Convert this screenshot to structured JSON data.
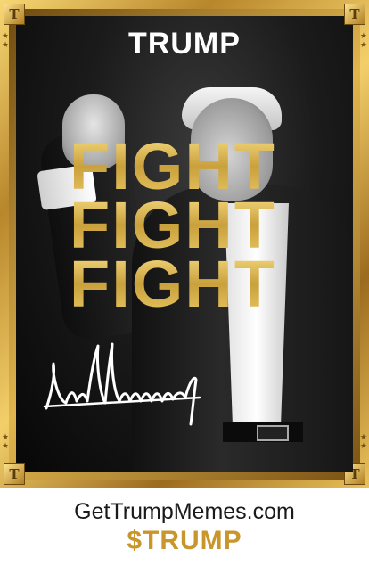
{
  "poster": {
    "title": "TRUMP",
    "fight_lines": [
      "FIGHT",
      "FIGHT",
      "FIGHT"
    ],
    "corner_badge": "T",
    "signature_icon": "signature-icon",
    "colors": {
      "gold": "#d4a843",
      "frame_dark": "#7a5214",
      "background": "#111111",
      "title": "#ffffff"
    }
  },
  "footer": {
    "url": "GetTrumpMemes.com",
    "ticker": "$TRUMP",
    "ticker_color": "#c8962b"
  }
}
